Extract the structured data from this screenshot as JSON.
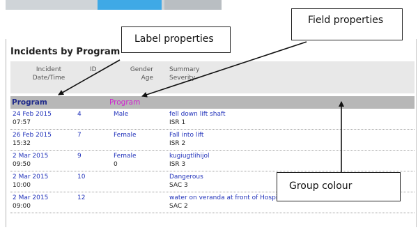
{
  "report": {
    "title": "Incidents by Program",
    "columns": [
      {
        "line1": "Incident",
        "line2": "Date/Time"
      },
      {
        "line1": "ID",
        "line2": ""
      },
      {
        "line1": "Gender",
        "line2": "Age"
      },
      {
        "line1": "Summary",
        "line2": "Severity"
      }
    ],
    "group": {
      "label": "Program",
      "field": "Program"
    },
    "rows": [
      {
        "date": "24 Feb 2015",
        "time": "07:57",
        "id": "4",
        "gender": "Male",
        "age": "",
        "summary": "fell down lift shaft",
        "severity": "ISR 1"
      },
      {
        "date": "26 Feb 2015",
        "time": "15:32",
        "id": "7",
        "gender": "Female",
        "age": "",
        "summary": "Fall into lift",
        "severity": "ISR 2"
      },
      {
        "date": "2 Mar 2015",
        "time": "09:50",
        "id": "9",
        "gender": "Female",
        "age": "0",
        "summary": "kugiugtlihijol",
        "severity": "ISR 3"
      },
      {
        "date": "2 Mar 2015",
        "time": "10:00",
        "id": "10",
        "gender": "",
        "age": "",
        "summary": "Dangerous",
        "severity": "SAC 3"
      },
      {
        "date": "2 Mar 2015",
        "time": "09:00",
        "id": "12",
        "gender": "",
        "age": "",
        "summary": "water on veranda at front of Hospital",
        "severity": "SAC 2"
      }
    ]
  },
  "callouts": {
    "label_properties": "Label properties",
    "field_properties": "Field properties",
    "group_colour": "Group colour"
  },
  "colors": {
    "group_background": "#b7b7b7",
    "group_label": "#1f2a8a",
    "group_field": "#d020d0",
    "data_text": "#2233bb",
    "tab_active": "#3fa9e6"
  }
}
